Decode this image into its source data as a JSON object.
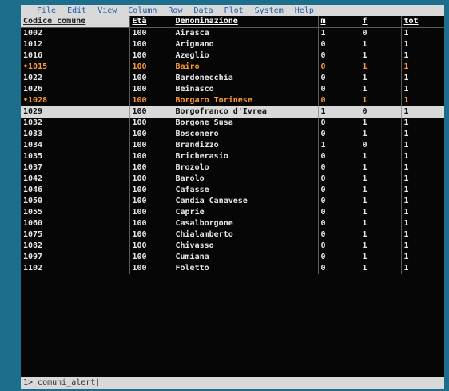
{
  "menu": [
    "File",
    "Edit",
    "View",
    "Column",
    "Row",
    "Data",
    "Plot",
    "System",
    "Help"
  ],
  "columns": [
    "Codice comune",
    "Età",
    "Denominazione",
    "m",
    "f",
    "tot"
  ],
  "rows": [
    {
      "cells": [
        "1002",
        "100",
        "Airasca",
        "1",
        "0",
        "1"
      ],
      "state": "normal"
    },
    {
      "cells": [
        "1012",
        "100",
        "Arignano",
        "0",
        "1",
        "1"
      ],
      "state": "normal"
    },
    {
      "cells": [
        "1016",
        "100",
        "Azeglio",
        "0",
        "1",
        "1"
      ],
      "state": "normal"
    },
    {
      "cells": [
        "1015",
        "100",
        "Bairo",
        "0",
        "1",
        "1"
      ],
      "state": "marked"
    },
    {
      "cells": [
        "1022",
        "100",
        "Bardonecchia",
        "0",
        "1",
        "1"
      ],
      "state": "normal"
    },
    {
      "cells": [
        "1026",
        "100",
        "Beinasco",
        "0",
        "1",
        "1"
      ],
      "state": "normal"
    },
    {
      "cells": [
        "1028",
        "100",
        "Borgaro Torinese",
        "0",
        "1",
        "1"
      ],
      "state": "marked"
    },
    {
      "cells": [
        "1029",
        "100",
        "Borgofranco d'Ivrea",
        "1",
        "0",
        "1"
      ],
      "state": "selected"
    },
    {
      "cells": [
        "1032",
        "100",
        "Borgone Susa",
        "0",
        "1",
        "1"
      ],
      "state": "normal"
    },
    {
      "cells": [
        "1033",
        "100",
        "Bosconero",
        "0",
        "1",
        "1"
      ],
      "state": "normal"
    },
    {
      "cells": [
        "1034",
        "100",
        "Brandizzo",
        "1",
        "0",
        "1"
      ],
      "state": "normal"
    },
    {
      "cells": [
        "1035",
        "100",
        "Bricherasio",
        "0",
        "1",
        "1"
      ],
      "state": "normal"
    },
    {
      "cells": [
        "1037",
        "100",
        "Brozolo",
        "0",
        "1",
        "1"
      ],
      "state": "normal"
    },
    {
      "cells": [
        "1042",
        "100",
        "Barolo",
        "0",
        "1",
        "1"
      ],
      "state": "normal"
    },
    {
      "cells": [
        "1046",
        "100",
        "Cafasse",
        "0",
        "1",
        "1"
      ],
      "state": "normal"
    },
    {
      "cells": [
        "1050",
        "100",
        "Candia Canavese",
        "0",
        "1",
        "1"
      ],
      "state": "normal"
    },
    {
      "cells": [
        "1055",
        "100",
        "Caprie",
        "0",
        "1",
        "1"
      ],
      "state": "normal"
    },
    {
      "cells": [
        "1060",
        "100",
        "Casalborgone",
        "0",
        "1",
        "1"
      ],
      "state": "normal"
    },
    {
      "cells": [
        "1075",
        "100",
        "Chialamberto",
        "0",
        "1",
        "1"
      ],
      "state": "normal"
    },
    {
      "cells": [
        "1082",
        "100",
        "Chivasso",
        "0",
        "1",
        "1"
      ],
      "state": "normal"
    },
    {
      "cells": [
        "1097",
        "100",
        "Cumiana",
        "0",
        "1",
        "1"
      ],
      "state": "normal"
    },
    {
      "cells": [
        "1102",
        "100",
        "Foletto",
        "0",
        "1",
        "1"
      ],
      "state": "normal"
    }
  ],
  "status": "1> comuni_alert|"
}
